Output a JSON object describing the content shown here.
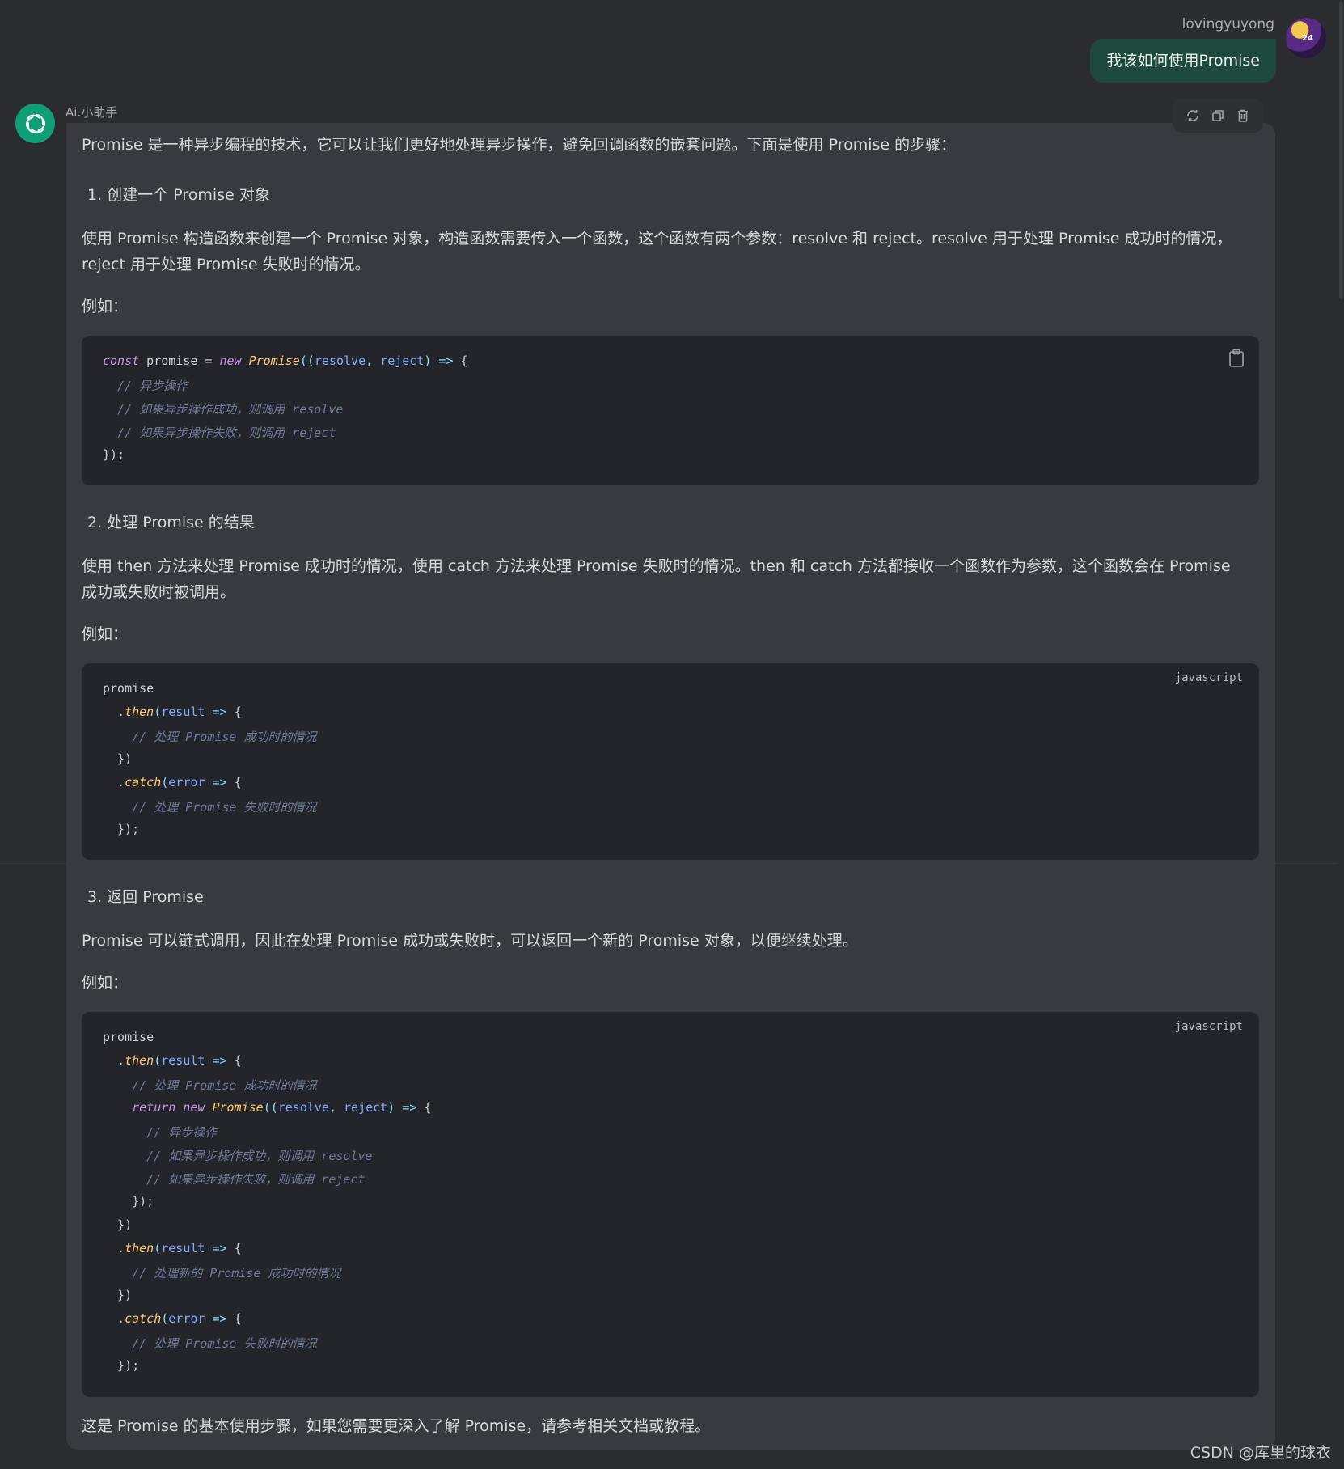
{
  "user": {
    "name": "lovingyuyong",
    "message": "我该如何使用Promise",
    "avatar_text": "24"
  },
  "assistant": {
    "name": "Ai.小助手",
    "intro": "Promise 是一种异步编程的技术，它可以让我们更好地处理异步操作，避免回调函数的嵌套问题。下面是使用 Promise 的步骤：",
    "step1_title": "1. 创建一个 Promise 对象",
    "step1_text": "使用 Promise 构造函数来创建一个 Promise 对象，构造函数需要传入一个函数，这个函数有两个参数：resolve 和 reject。resolve 用于处理 Promise 成功时的情况，reject 用于处理 Promise 失败时的情况。",
    "example_label": "例如：",
    "step2_title": "2. 处理 Promise 的结果",
    "step2_text": "使用 then 方法来处理 Promise 成功时的情况，使用 catch 方法来处理 Promise 失败时的情况。then 和 catch 方法都接收一个函数作为参数，这个函数会在 Promise 成功或失败时被调用。",
    "step3_title": "3. 返回 Promise",
    "step3_text": "Promise 可以链式调用，因此在处理 Promise 成功或失败时，可以返回一个新的 Promise 对象，以便继续处理。",
    "outro": "这是 Promise 的基本使用步骤，如果您需要更深入了解 Promise，请参考相关文档或教程。"
  },
  "actions": [
    "refresh-icon",
    "copy-icon",
    "trash-icon"
  ],
  "code_blocks": [
    {
      "lang": "",
      "lines": [
        [
          [
            "kw",
            "const"
          ],
          [
            "pl",
            " promise = "
          ],
          [
            "kw",
            "new"
          ],
          [
            "pl",
            " "
          ],
          [
            "fn",
            "Promise"
          ],
          [
            "op",
            "(("
          ],
          [
            "param",
            "resolve"
          ],
          [
            "op",
            ", "
          ],
          [
            "param",
            "reject"
          ],
          [
            "op",
            ") => "
          ],
          [
            "pl",
            "{"
          ]
        ],
        [
          [
            "cm",
            "  // 异步操作"
          ]
        ],
        [
          [
            "cm",
            "  // 如果异步操作成功，则调用 resolve"
          ]
        ],
        [
          [
            "cm",
            "  // 如果异步操作失败，则调用 reject"
          ]
        ],
        [
          [
            "pl",
            "});"
          ]
        ]
      ]
    },
    {
      "lang": "javascript",
      "lines": [
        [
          [
            "pl",
            "promise"
          ]
        ],
        [
          [
            "pl",
            "  ."
          ],
          [
            "fn",
            "then"
          ],
          [
            "op",
            "("
          ],
          [
            "param",
            "result"
          ],
          [
            "op",
            " => "
          ],
          [
            "pl",
            "{"
          ]
        ],
        [
          [
            "cm",
            "    // 处理 Promise 成功时的情况"
          ]
        ],
        [
          [
            "pl",
            "  })"
          ]
        ],
        [
          [
            "pl",
            "  ."
          ],
          [
            "fn",
            "catch"
          ],
          [
            "op",
            "("
          ],
          [
            "param",
            "error"
          ],
          [
            "op",
            " => "
          ],
          [
            "pl",
            "{"
          ]
        ],
        [
          [
            "cm",
            "    // 处理 Promise 失败时的情况"
          ]
        ],
        [
          [
            "pl",
            "  });"
          ]
        ]
      ]
    },
    {
      "lang": "javascript",
      "lines": [
        [
          [
            "pl",
            "promise"
          ]
        ],
        [
          [
            "pl",
            "  ."
          ],
          [
            "fn",
            "then"
          ],
          [
            "op",
            "("
          ],
          [
            "param",
            "result"
          ],
          [
            "op",
            " => "
          ],
          [
            "pl",
            "{"
          ]
        ],
        [
          [
            "cm",
            "    // 处理 Promise 成功时的情况"
          ]
        ],
        [
          [
            "kw",
            "    return"
          ],
          [
            "pl",
            " "
          ],
          [
            "kw",
            "new"
          ],
          [
            "pl",
            " "
          ],
          [
            "fn",
            "Promise"
          ],
          [
            "op",
            "(("
          ],
          [
            "param",
            "resolve"
          ],
          [
            "op",
            ", "
          ],
          [
            "param",
            "reject"
          ],
          [
            "op",
            ") => "
          ],
          [
            "pl",
            "{"
          ]
        ],
        [
          [
            "cm",
            "      // 异步操作"
          ]
        ],
        [
          [
            "cm",
            "      // 如果异步操作成功，则调用 resolve"
          ]
        ],
        [
          [
            "cm",
            "      // 如果异步操作失败，则调用 reject"
          ]
        ],
        [
          [
            "pl",
            "    });"
          ]
        ],
        [
          [
            "pl",
            "  })"
          ]
        ],
        [
          [
            "pl",
            "  ."
          ],
          [
            "fn",
            "then"
          ],
          [
            "op",
            "("
          ],
          [
            "param",
            "result"
          ],
          [
            "op",
            " => "
          ],
          [
            "pl",
            "{"
          ]
        ],
        [
          [
            "cm",
            "    // 处理新的 Promise 成功时的情况"
          ]
        ],
        [
          [
            "pl",
            "  })"
          ]
        ],
        [
          [
            "pl",
            "  ."
          ],
          [
            "fn",
            "catch"
          ],
          [
            "op",
            "("
          ],
          [
            "param",
            "error"
          ],
          [
            "op",
            " => "
          ],
          [
            "pl",
            "{"
          ]
        ],
        [
          [
            "cm",
            "    // 处理 Promise 失败时的情况"
          ]
        ],
        [
          [
            "pl",
            "  });"
          ]
        ]
      ]
    }
  ],
  "watermark": "CSDN @库里的球衣",
  "colors": {
    "background": "#2b2c30",
    "card": "#393a3f",
    "code_bg": "#24252a",
    "user_bubble": "#1e4a3d",
    "ai_avatar": "#0f9f76"
  }
}
